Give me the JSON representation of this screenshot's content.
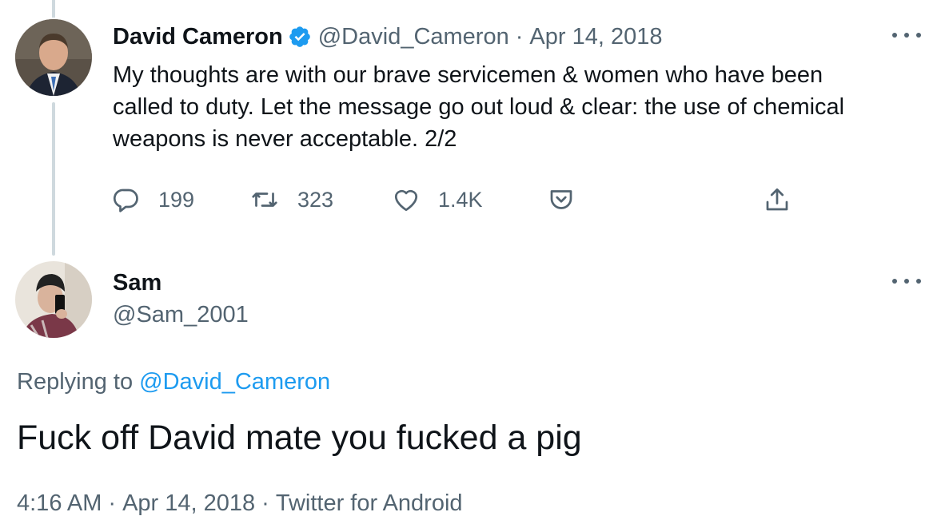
{
  "tweet": {
    "author_name": "David Cameron",
    "author_handle": "@David_Cameron",
    "separator": "·",
    "date": "Apr 14, 2018",
    "text": "My thoughts are with our brave servicemen & women who have been\ncalled to duty. Let the message go out loud & clear: the use of chemical\nweapons is never acceptable. 2/2",
    "replies": "199",
    "retweets": "323",
    "likes": "1.4K",
    "icons": [
      "comment-icon",
      "retweet-icon",
      "heart-icon",
      "bookmark-icon",
      "share-icon",
      "verified-badge-icon",
      "more-icon"
    ]
  },
  "reply": {
    "author_name": "Sam",
    "author_handle": "@Sam_2001",
    "replying_to_prefix": "Replying to",
    "replying_to_handle": "@David_Cameron",
    "text": "Fuck off David mate you fucked a pig",
    "time": "4:16 AM",
    "separator1": "·",
    "date": "Apr 14, 2018",
    "separator2": "·",
    "source": "Twitter for Android"
  },
  "colors": {
    "text": "#0f1419",
    "muted": "#536471",
    "accent": "#1d9bf0",
    "thread_line": "#cfd9de"
  }
}
